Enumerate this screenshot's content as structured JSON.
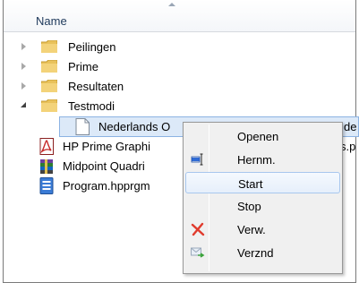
{
  "header": {
    "name_column": "Name"
  },
  "tree": {
    "folders": [
      {
        "label": "Peilingen",
        "state": "collapsed"
      },
      {
        "label": "Prime",
        "state": "collapsed"
      },
      {
        "label": "Resultaten",
        "state": "collapsed"
      },
      {
        "label": "Testmodi",
        "state": "expanded"
      }
    ],
    "files": [
      {
        "label": "Nederlands O",
        "icon": "document-icon",
        "selected": true
      },
      {
        "label": "HP Prime Graphi",
        "icon": "pdf-icon",
        "suffix": "s.p"
      },
      {
        "label": "Midpoint Quadri",
        "icon": "archive-icon"
      },
      {
        "label": "Program.hpprgm",
        "icon": "program-icon"
      }
    ],
    "selected_suffix": "de"
  },
  "context_menu": {
    "items": [
      {
        "label": "Openen",
        "icon": ""
      },
      {
        "label": "Hernm.",
        "icon": "rename-icon"
      },
      {
        "label": "Start",
        "icon": "",
        "highlighted": true
      },
      {
        "label": "Stop",
        "icon": ""
      },
      {
        "label": "Verw.",
        "icon": "delete-icon"
      },
      {
        "label": "Verznd",
        "icon": "send-icon"
      }
    ]
  },
  "colors": {
    "selection": "#dce9f8",
    "folder": "#e9c25b",
    "delete": "#e03b2d",
    "accent": "#2f6bd6"
  }
}
